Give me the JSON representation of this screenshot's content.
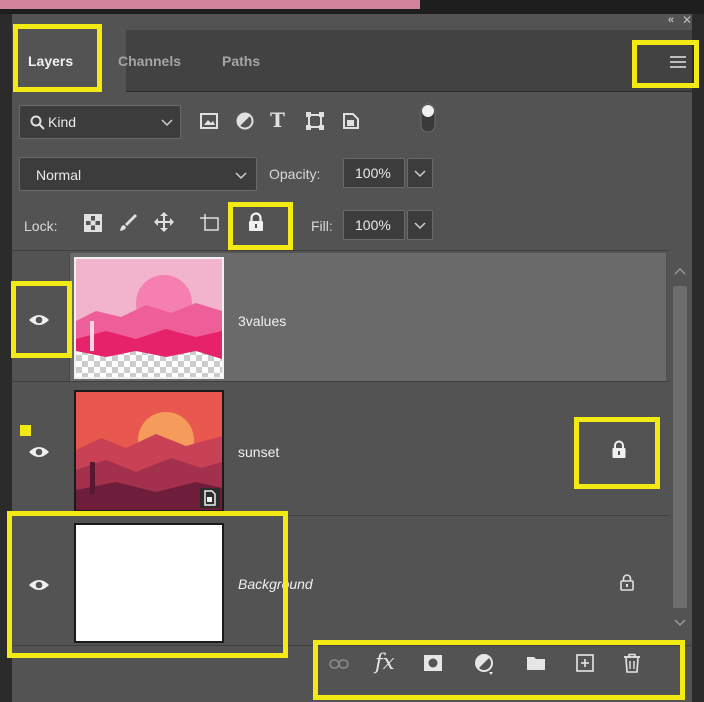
{
  "window": {
    "collapse_glyph": "«",
    "close_glyph": "✕"
  },
  "tabs": [
    {
      "label": "Layers",
      "active": true
    },
    {
      "label": "Channels",
      "active": false
    },
    {
      "label": "Paths",
      "active": false
    }
  ],
  "filter": {
    "kind_label": "Kind"
  },
  "blend": {
    "mode": "Normal",
    "opacity_label": "Opacity:",
    "opacity_value": "100%"
  },
  "lock": {
    "label": "Lock:",
    "fill_label": "Fill:",
    "fill_value": "100%"
  },
  "layers": [
    {
      "name": "3values",
      "visible": true,
      "selected": true,
      "locked": false
    },
    {
      "name": "sunset",
      "visible": true,
      "selected": false,
      "locked": true
    },
    {
      "name": "Background",
      "visible": true,
      "selected": false,
      "locked": true,
      "italic": true
    }
  ],
  "colors": {
    "highlight": "#f2ea12",
    "panel": "#535353",
    "selected_row": "#6a6a6a"
  }
}
